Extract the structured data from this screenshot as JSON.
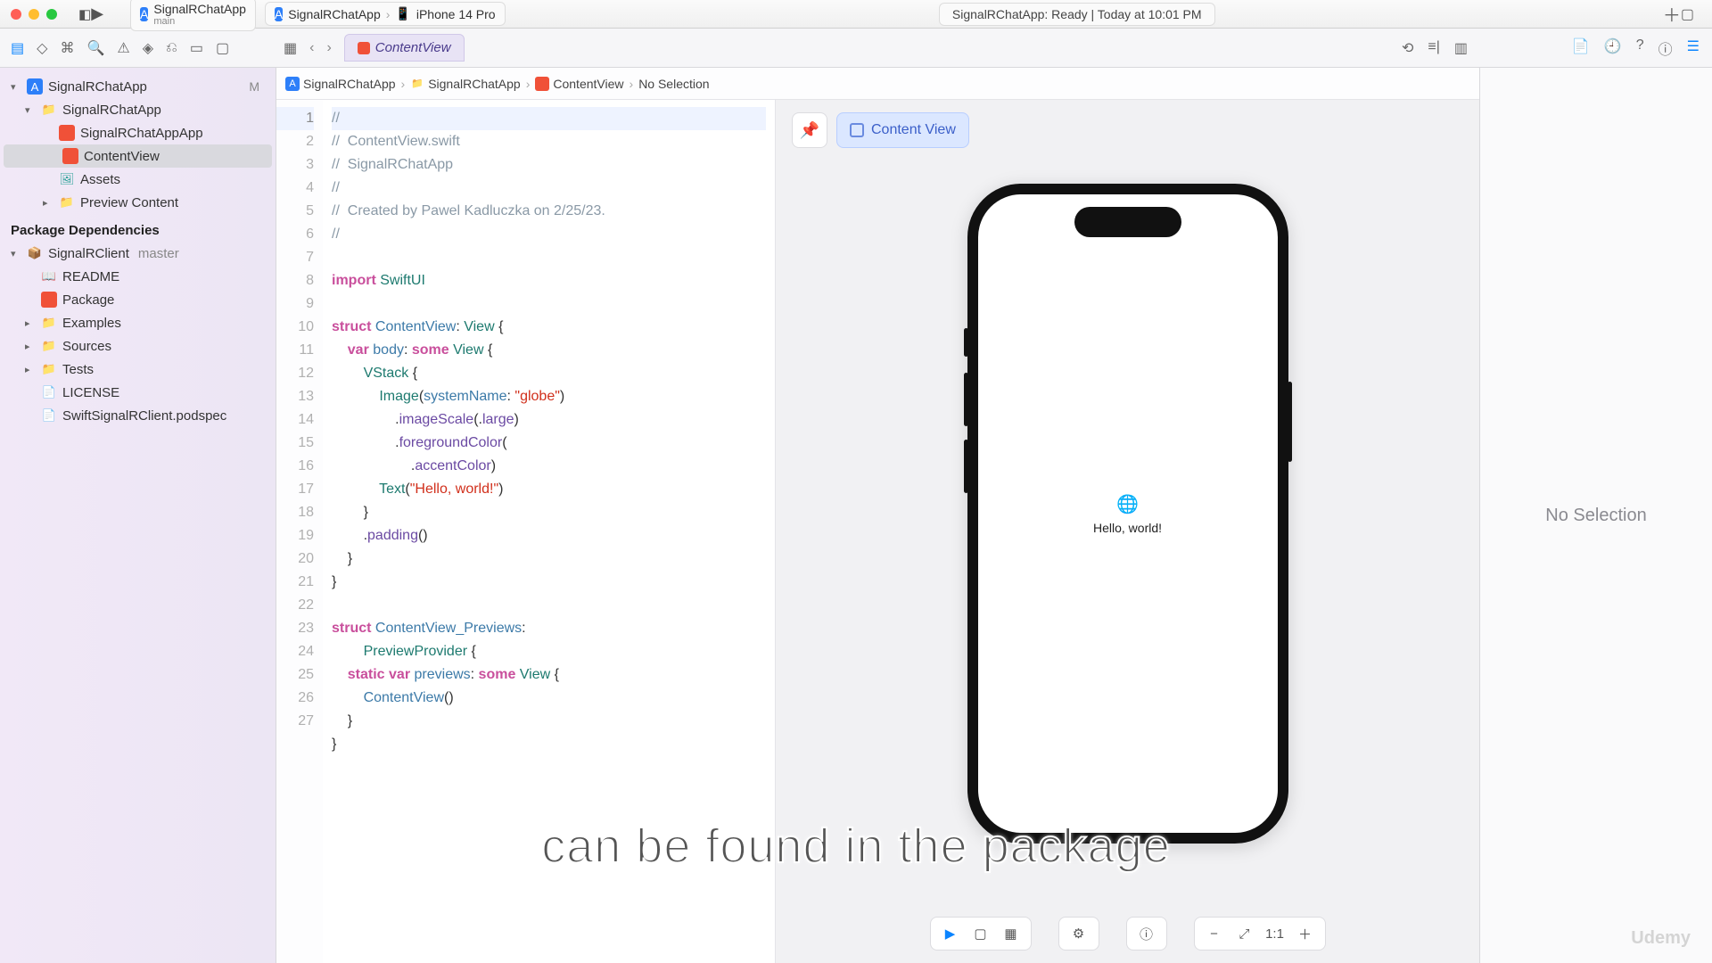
{
  "window": {
    "scheme_name": "SignalRChatApp",
    "scheme_sub": "main",
    "scheme_target": "SignalRChatApp",
    "device": "iPhone 14 Pro",
    "status": "SignalRChatApp: Ready | Today at 10:01 PM"
  },
  "tab": {
    "label": "ContentView"
  },
  "crumb": {
    "a": "SignalRChatApp",
    "b": "SignalRChatApp",
    "c": "ContentView",
    "d": "No Selection"
  },
  "sidebar": {
    "root": "SignalRChatApp",
    "root_badge": "M",
    "group": "SignalRChatApp",
    "app_file": "SignalRChatAppApp",
    "cv_file": "ContentView",
    "assets": "Assets",
    "preview": "Preview Content",
    "deps_header": "Package Dependencies",
    "client": "SignalRClient",
    "client_branch": "master",
    "readme": "README",
    "package": "Package",
    "examples": "Examples",
    "sources": "Sources",
    "tests": "Tests",
    "license": "LICENSE",
    "podspec": "SwiftSignalRClient.podspec"
  },
  "code": {
    "lines": [
      "//",
      "//  ContentView.swift",
      "//  SignalRChatApp",
      "//",
      "//  Created by Pawel Kadluczka on 2/25/23.",
      "//",
      "",
      "import SwiftUI",
      "",
      "struct ContentView: View {",
      "    var body: some View {",
      "        VStack {",
      "            Image(systemName: \"globe\")",
      "                .imageScale(.large)",
      "                .foregroundColor(",
      "                    .accentColor)",
      "            Text(\"Hello, world!\")",
      "        }",
      "        .padding()",
      "    }",
      "}",
      "",
      "struct ContentView_Previews:",
      "        PreviewProvider {",
      "    static var previews: some View {",
      "        ContentView()",
      "    }",
      "}",
      ""
    ],
    "line_numbers": [
      "1",
      "2",
      "3",
      "4",
      "5",
      "6",
      "7",
      "8",
      "9",
      "10",
      "11",
      "12",
      "13",
      "14",
      "15",
      "16",
      "17",
      "18",
      "19",
      "20",
      "21",
      "22",
      "23",
      "24",
      "25",
      "26",
      "27"
    ]
  },
  "preview": {
    "chip": "Content View",
    "hello": "Hello, world!"
  },
  "inspector": {
    "placeholder": "No Selection"
  },
  "subtitle": "can be found in the package",
  "watermark": "Udemy"
}
